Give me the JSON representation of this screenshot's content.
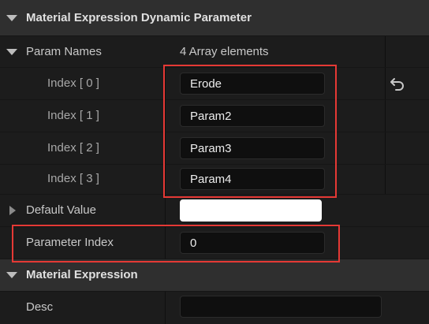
{
  "category_dynamic": {
    "title": "Material Expression Dynamic Parameter"
  },
  "param_names": {
    "label": "Param Names",
    "summary": "4 Array elements",
    "elements": [
      {
        "label": "Index [ 0 ]",
        "value": "Erode"
      },
      {
        "label": "Index [ 1 ]",
        "value": "Param2"
      },
      {
        "label": "Index [ 2 ]",
        "value": "Param3"
      },
      {
        "label": "Index [ 3 ]",
        "value": "Param4"
      }
    ],
    "reset_icon": "undo-arrow-icon"
  },
  "default_value": {
    "label": "Default Value",
    "value": ""
  },
  "parameter_index": {
    "label": "Parameter Index",
    "value": "0"
  },
  "category_material": {
    "title": "Material Expression"
  },
  "desc": {
    "label": "Desc",
    "value": ""
  },
  "colors": {
    "highlight": "#e53935",
    "category_bg": "#2f2f2f",
    "row_bg": "#1c1c1c"
  }
}
